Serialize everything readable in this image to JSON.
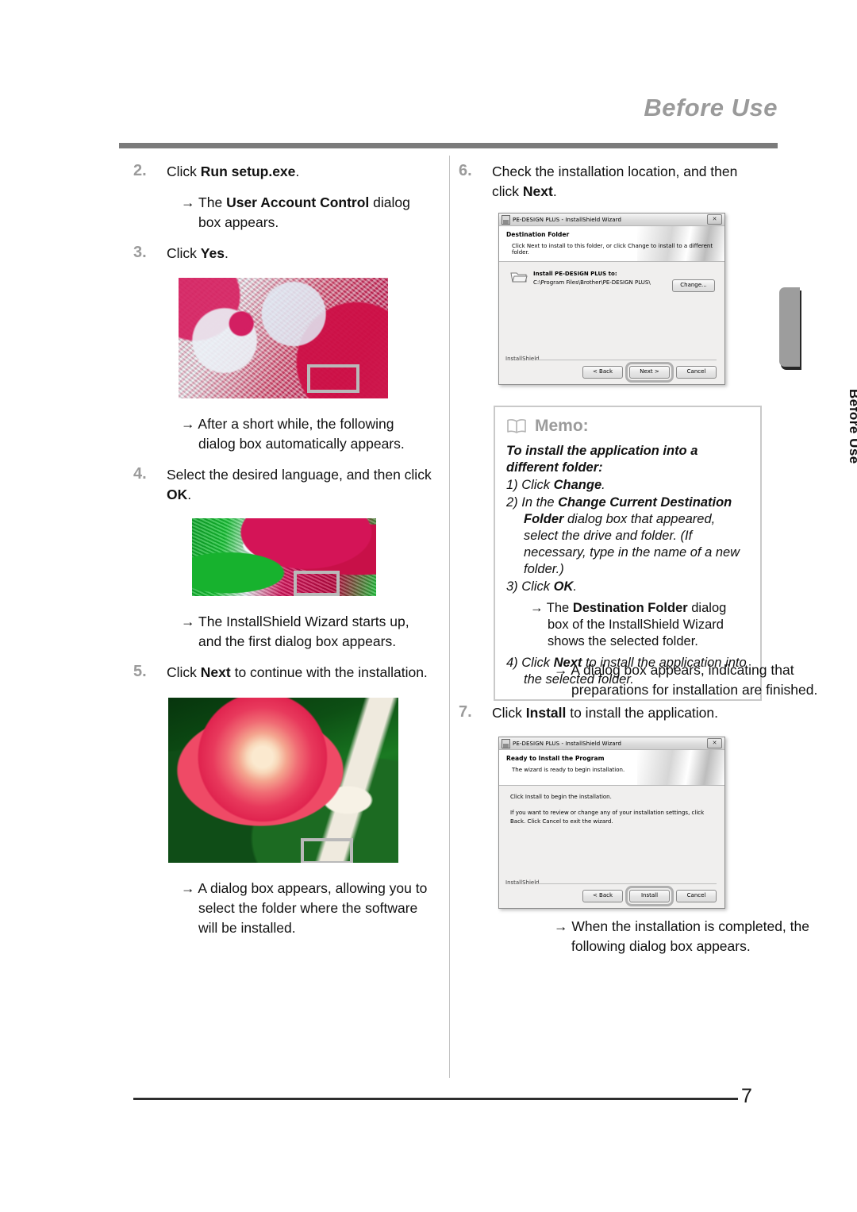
{
  "header": {
    "title": "Before Use"
  },
  "side_tab": {
    "label": "Before Use"
  },
  "footer": {
    "page_number": "7"
  },
  "left_column": {
    "step2": {
      "num": "2.",
      "text_pre": "Click ",
      "text_bold": "Run setup.exe",
      "text_post": "."
    },
    "step2_sub": {
      "arrow": "→",
      "pre": "The ",
      "bold": "User Account Control",
      "post": " dialog box appears."
    },
    "step3": {
      "num": "3.",
      "text_pre": "Click ",
      "text_bold": "Yes",
      "text_post": "."
    },
    "image1": {
      "alt": "setup-language-dialog-screenshot",
      "highlight": "ok-button-highlight"
    },
    "image1_sub": {
      "arrow": "→",
      "text": "After a short while, the following dialog box automatically appears."
    },
    "step4": {
      "num": "4.",
      "text_pre": "Select the desired language, and then click ",
      "text_bold": "OK",
      "text_post": "."
    },
    "image2": {
      "alt": "installshield-wizard-first-dialog-screenshot",
      "highlight": "next-button-highlight"
    },
    "image2_sub": {
      "arrow": "→",
      "text": "The InstallShield Wizard starts up, and the first dialog box appears."
    },
    "step5": {
      "num": "5.",
      "text_pre": "Click ",
      "text_bold": "Next",
      "text_post": " to continue with the installation."
    },
    "image3": {
      "alt": "license-agreement-dialog-screenshot",
      "highlight": "next-button-highlight"
    },
    "image3_sub": {
      "arrow": "→",
      "text": "A dialog box appears, allowing you to select the folder where the software will be installed."
    }
  },
  "right_column": {
    "step6": {
      "num": "6.",
      "text_pre": "Check the installation location, and then click ",
      "text_bold": "Next",
      "text_post": "."
    },
    "step7": {
      "num": "7.",
      "text_pre": "Click ",
      "text_bold": "Install",
      "text_post": " to install the application."
    },
    "dialog6_sub": {
      "arrow": "→",
      "text": "A dialog box appears, indicating that preparations for installation are finished."
    },
    "dialog7_sub": {
      "arrow": "→",
      "text": "When the installation is completed, the following dialog box appears."
    }
  },
  "memo": {
    "icon": "open-book-icon",
    "title": "Memo:",
    "lead": "To install the application into a different folder:",
    "items": [
      {
        "marker": "1)",
        "pre": "Click ",
        "bold": "Change",
        "post": "."
      },
      {
        "marker": "2)",
        "pre": "In the ",
        "bold": "Change Current Destination Folder",
        "post": " dialog box that appeared, select the drive and folder. (If necessary, type in the name of a new folder.)"
      },
      {
        "marker": "3)",
        "pre": "Click ",
        "bold": "OK",
        "post": "."
      }
    ],
    "sub_item": {
      "arrow": "→",
      "pre": "The ",
      "bold": "Destination Folder",
      "post": " dialog box of the InstallShield Wizard shows the selected folder."
    },
    "item4": {
      "marker": "4)",
      "pre": "Click ",
      "bold": "Next",
      "post": " to install the application into the selected folder."
    }
  },
  "dialog_destination": {
    "title": "PE-DESIGN PLUS - InstallShield Wizard",
    "close_label": "✕",
    "banner_heading": "Destination Folder",
    "banner_sub": "Click Next to install to this folder, or click Change to install to a different folder.",
    "install_label": "Install PE-DESIGN PLUS to:",
    "install_path": "C:\\Program Files\\Brother\\PE-DESIGN PLUS\\",
    "change_button": "Change...",
    "footer_label": "InstallShield",
    "back_button": "< Back",
    "next_button": "Next >",
    "cancel_button": "Cancel"
  },
  "dialog_ready": {
    "title": "PE-DESIGN PLUS - InstallShield Wizard",
    "close_label": "✕",
    "banner_heading": "Ready to Install the Program",
    "banner_sub": "The wizard is ready to begin installation.",
    "para1": "Click Install to begin the installation.",
    "para2": "If you want to review or change any of your installation settings, click Back. Click Cancel to exit the wizard.",
    "footer_label": "InstallShield",
    "back_button": "< Back",
    "install_button": "Install",
    "cancel_button": "Cancel"
  },
  "colors": {
    "header_gray": "#9a9a9a",
    "rule_gray": "#7b7b7b",
    "step_num_gray": "#9b9b9b",
    "memo_border": "#c9c9c9",
    "highlight_gray": "#b0b0b0"
  }
}
